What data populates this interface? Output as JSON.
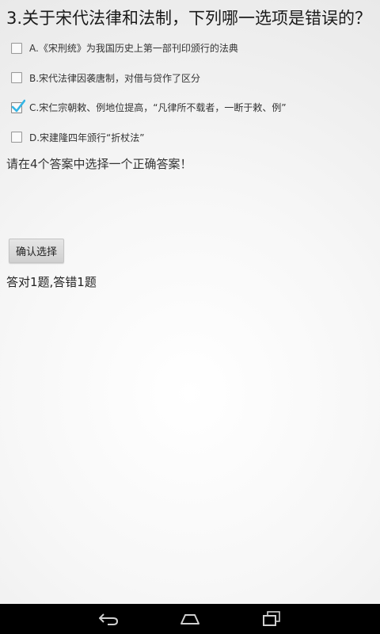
{
  "question": {
    "text": "3.关于宋代法律和法制，下列哪一选项是错误的？"
  },
  "options": [
    {
      "label": "A.《宋刑统》为我国历史上第一部刊印颁行的法典",
      "checked": false
    },
    {
      "label": "B.宋代法律因袭唐制，对借与贷作了区分",
      "checked": false
    },
    {
      "label": "C.宋仁宗朝敕、例地位提高，“凡律所不载者，一断于敕、例”",
      "checked": true
    },
    {
      "label": "D.宋建隆四年颁行“折杖法”",
      "checked": false
    }
  ],
  "hint": "请在4个答案中选择一个正确答案！",
  "confirm_button": "确认选择",
  "score": "答对1题,答错1题",
  "colors": {
    "check_mark": "#33b5e5",
    "navbar": "#000000",
    "nav_icon": "#d0d0d0"
  },
  "navbar": {
    "icons": [
      "back-icon",
      "home-icon",
      "recent-apps-icon"
    ]
  }
}
